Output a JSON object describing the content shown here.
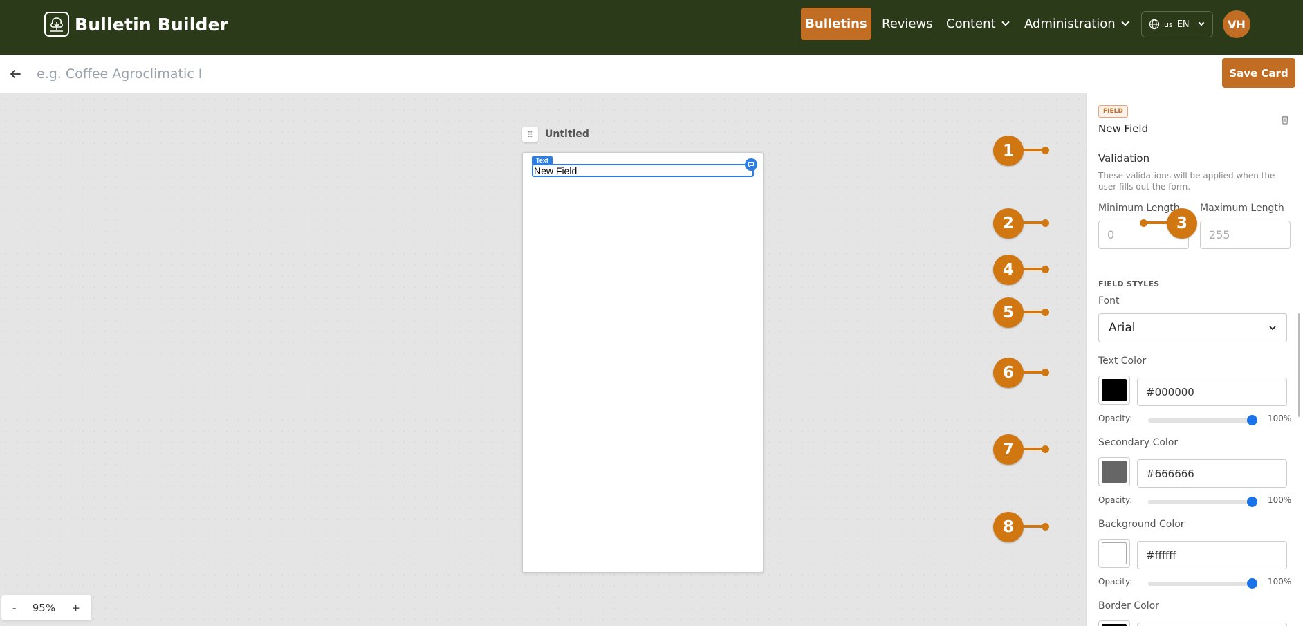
{
  "app": {
    "title": "Bulletin Builder"
  },
  "nav": {
    "bulletins": "Bulletins",
    "reviews": "Reviews",
    "content": "Content",
    "administration": "Administration",
    "lang_flag": "us",
    "lang_code": "EN",
    "avatar": "VH"
  },
  "header": {
    "title_placeholder": "e.g. Coffee Agroclimatic I",
    "save_label": "Save Card"
  },
  "canvas": {
    "card_title": "Untitled",
    "field_tag": "Text",
    "field_text": "New Field",
    "zoom_minus": "-",
    "zoom_level": "95%",
    "zoom_plus": "+"
  },
  "annotations": [
    "1",
    "2",
    "3",
    "4",
    "5",
    "6",
    "7",
    "8"
  ],
  "panel": {
    "badge": "FIELD",
    "field_name": "New Field",
    "validation": {
      "heading": "Validation",
      "help": "These validations will be applied when the user fills out the form.",
      "min_label": "Minimum Length",
      "min_placeholder": "0",
      "max_label": "Maximum Length",
      "max_placeholder": "255"
    },
    "styles": {
      "section": "FIELD STYLES",
      "font_label": "Font",
      "font_value": "Arial",
      "text_color": {
        "label": "Text Color",
        "hex": "#000000",
        "opacity_label": "Opacity:",
        "opacity": "100%"
      },
      "secondary_color": {
        "label": "Secondary Color",
        "hex": "#666666",
        "opacity_label": "Opacity:",
        "opacity": "100%"
      },
      "background_color": {
        "label": "Background Color",
        "hex": "#ffffff",
        "opacity_label": "Opacity:",
        "opacity": "100%"
      },
      "border_color": {
        "label": "Border Color"
      }
    }
  },
  "colors": {
    "nav_bg": "#2b3a19",
    "accent": "#c16d24",
    "annotation": "#d07712",
    "selection_blue": "#2f7de1"
  }
}
